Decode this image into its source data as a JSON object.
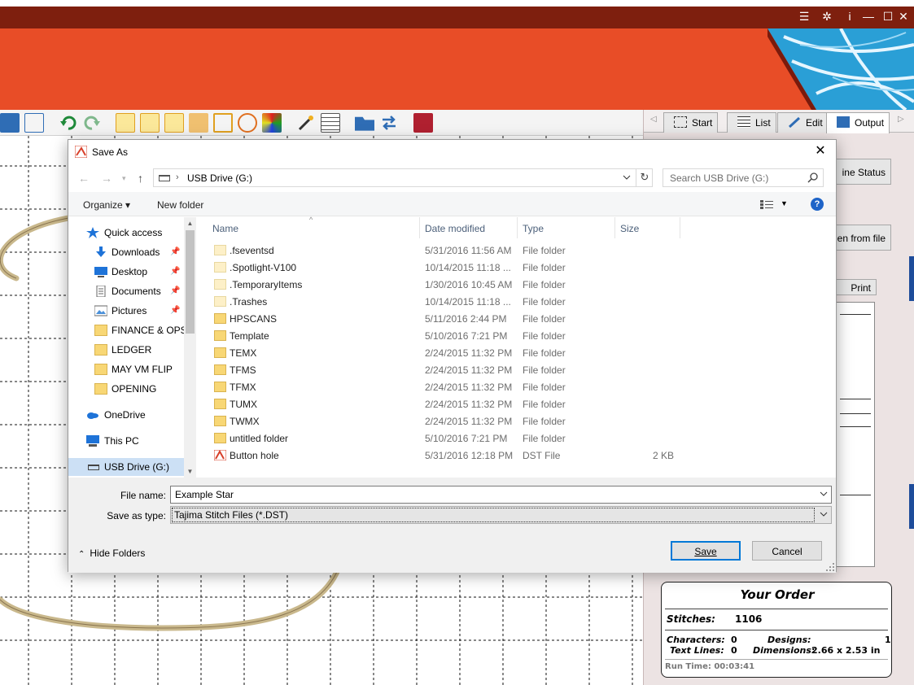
{
  "app": {
    "window_controls": [
      "☰",
      "✲",
      "i",
      "—",
      "☐",
      "✕"
    ],
    "tabs": [
      {
        "label": "Start",
        "icon": "start-icon"
      },
      {
        "label": "List",
        "icon": "list-icon"
      },
      {
        "label": "Edit",
        "icon": "pencil-icon"
      },
      {
        "label": "Output",
        "icon": "monitor-icon"
      }
    ],
    "panel_buttons": {
      "machine_status": "ine Status",
      "open_from_file": "en from file",
      "print": "Print"
    },
    "order": {
      "title": "Your Order",
      "stitches_label": "Stitches:",
      "stitches_value": "1106",
      "characters_label": "Characters:",
      "characters_value": "0",
      "text_lines_label": "Text Lines:",
      "text_lines_value": "0",
      "designs_label": "Designs:",
      "designs_value": "1",
      "dimensions_label": "Dimensions:",
      "dimensions_value": "2.66 x 2.53 in",
      "run_time": "Run Time: 00:03:41"
    },
    "colors": {
      "titlebar": "#7e1f0e",
      "banner": "#e84d27",
      "accent_blue": "#0078d7"
    }
  },
  "dialog": {
    "title": "Save As",
    "address": {
      "separator": "›",
      "location": "USB Drive (G:)"
    },
    "search_placeholder": "Search USB Drive (G:)",
    "command_bar": {
      "organize": "Organize ▾",
      "new_folder": "New folder",
      "help": "?"
    },
    "nav": [
      {
        "label": "Quick access",
        "icon": "star-icon",
        "pinned": false
      },
      {
        "label": "Downloads",
        "icon": "download-icon",
        "pinned": true
      },
      {
        "label": "Desktop",
        "icon": "desktop-icon",
        "pinned": true
      },
      {
        "label": "Documents",
        "icon": "documents-icon",
        "pinned": true
      },
      {
        "label": "Pictures",
        "icon": "pictures-icon",
        "pinned": true
      },
      {
        "label": "FINANCE & OPS",
        "icon": "folder-icon",
        "pinned": false
      },
      {
        "label": "LEDGER",
        "icon": "folder-icon",
        "pinned": false
      },
      {
        "label": "MAY VM FLIP",
        "icon": "folder-icon",
        "pinned": false
      },
      {
        "label": "OPENING",
        "icon": "folder-icon",
        "pinned": false
      },
      {
        "label": "OneDrive",
        "icon": "cloud-icon",
        "pinned": false
      },
      {
        "label": "This PC",
        "icon": "pc-icon",
        "pinned": false
      },
      {
        "label": "USB Drive (G:)",
        "icon": "drive-icon",
        "pinned": false,
        "selected": true
      }
    ],
    "columns": [
      "Name",
      "Date modified",
      "Type",
      "Size"
    ],
    "files": [
      {
        "name": ".fseventsd",
        "date": "5/31/2016 11:56 AM",
        "type": "File folder",
        "size": "",
        "icon": "folder-light-icon"
      },
      {
        "name": ".Spotlight-V100",
        "date": "10/14/2015 11:18 ...",
        "type": "File folder",
        "size": "",
        "icon": "folder-light-icon"
      },
      {
        "name": ".TemporaryItems",
        "date": "1/30/2016 10:45 AM",
        "type": "File folder",
        "size": "",
        "icon": "folder-light-icon"
      },
      {
        "name": ".Trashes",
        "date": "10/14/2015 11:18 ...",
        "type": "File folder",
        "size": "",
        "icon": "folder-light-icon"
      },
      {
        "name": "HPSCANS",
        "date": "5/11/2016 2:44 PM",
        "type": "File folder",
        "size": "",
        "icon": "folder-icon"
      },
      {
        "name": "Template",
        "date": "5/10/2016 7:21 PM",
        "type": "File folder",
        "size": "",
        "icon": "folder-icon"
      },
      {
        "name": "TEMX",
        "date": "2/24/2015 11:32 PM",
        "type": "File folder",
        "size": "",
        "icon": "folder-icon"
      },
      {
        "name": "TFMS",
        "date": "2/24/2015 11:32 PM",
        "type": "File folder",
        "size": "",
        "icon": "folder-icon"
      },
      {
        "name": "TFMX",
        "date": "2/24/2015 11:32 PM",
        "type": "File folder",
        "size": "",
        "icon": "folder-icon"
      },
      {
        "name": "TUMX",
        "date": "2/24/2015 11:32 PM",
        "type": "File folder",
        "size": "",
        "icon": "folder-icon"
      },
      {
        "name": "TWMX",
        "date": "2/24/2015 11:32 PM",
        "type": "File folder",
        "size": "",
        "icon": "folder-icon"
      },
      {
        "name": "untitled folder",
        "date": "5/10/2016 7:21 PM",
        "type": "File folder",
        "size": "",
        "icon": "folder-icon"
      },
      {
        "name": "Button hole",
        "date": "5/31/2016 12:18 PM",
        "type": "DST File",
        "size": "2 KB",
        "icon": "dst-file-icon"
      }
    ],
    "file_name_label": "File name:",
    "file_name_value": "Example Star",
    "save_as_type_label": "Save as type:",
    "save_as_type_value": "Tajima Stitch Files (*.DST)",
    "hide_folders": "Hide Folders",
    "save_button": "Save",
    "cancel_button": "Cancel"
  }
}
